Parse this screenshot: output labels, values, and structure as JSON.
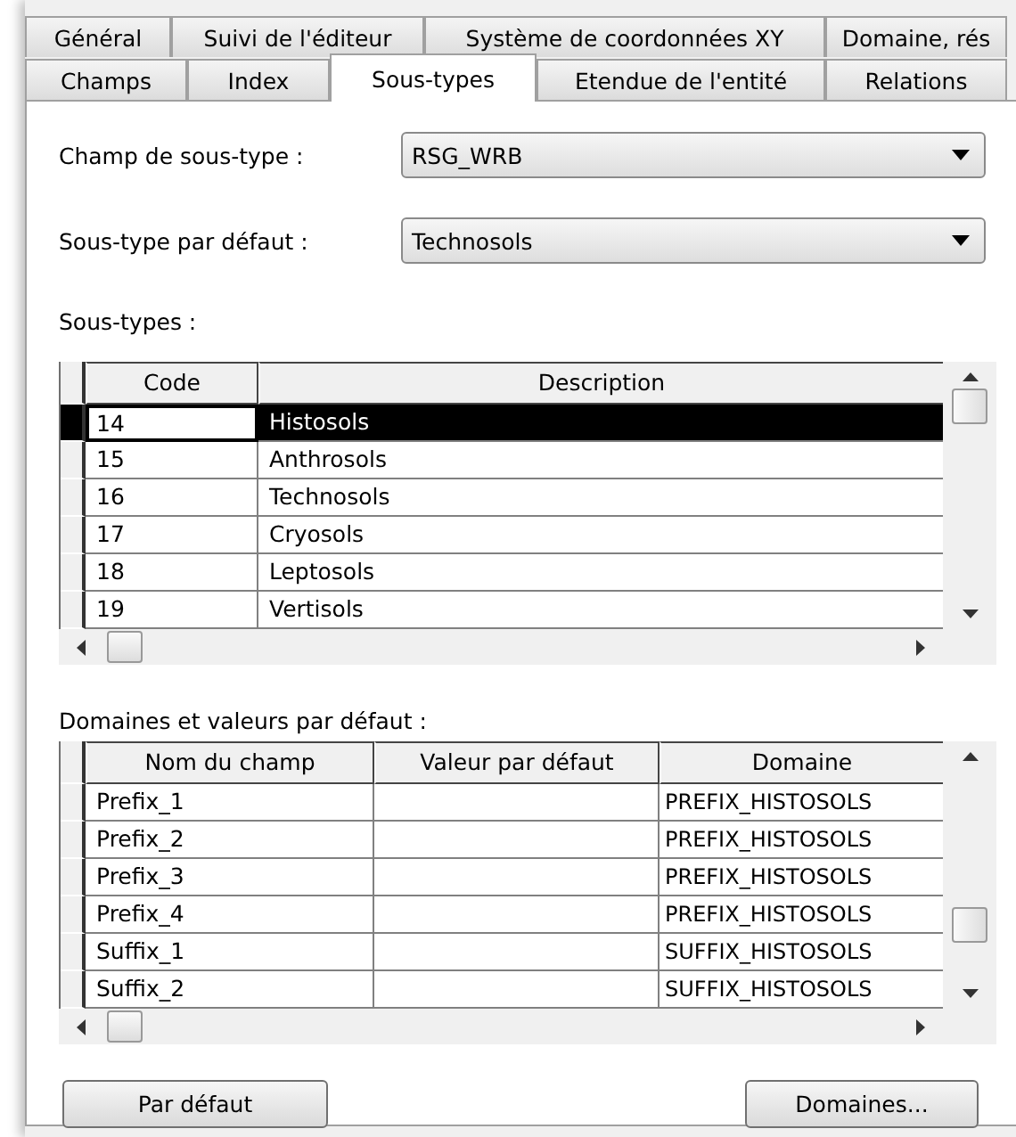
{
  "tab_rows": [
    [
      {
        "label": "Général",
        "selected": false
      },
      {
        "label": "Suivi de l'éditeur",
        "selected": false
      },
      {
        "label": "Système de coordonnées XY",
        "selected": false
      },
      {
        "label": "Domaine, rés",
        "selected": false
      }
    ],
    [
      {
        "label": "Champs",
        "selected": false
      },
      {
        "label": "Index",
        "selected": false
      },
      {
        "label": "Sous-types",
        "selected": true
      },
      {
        "label": "Etendue de l'entité",
        "selected": false
      },
      {
        "label": "Relations",
        "selected": false
      }
    ]
  ],
  "subtype_field": {
    "label": "Champ de sous-type :",
    "value": "RSG_WRB"
  },
  "default_subtype": {
    "label": "Sous-type par défaut :",
    "value": "Technosols"
  },
  "subtypes_label": "Sous-types :",
  "subtypes_table": {
    "columns": [
      "Code",
      "Description"
    ],
    "rows": [
      {
        "cells": [
          "14",
          "Histosols"
        ],
        "selected": true
      },
      {
        "cells": [
          "15",
          "Anthrosols"
        ],
        "selected": false
      },
      {
        "cells": [
          "16",
          "Technosols"
        ],
        "selected": false
      },
      {
        "cells": [
          "17",
          "Cryosols"
        ],
        "selected": false
      },
      {
        "cells": [
          "18",
          "Leptosols"
        ],
        "selected": false
      },
      {
        "cells": [
          "19",
          "Vertisols"
        ],
        "selected": false
      }
    ]
  },
  "domains_label": "Domaines et valeurs par défaut :",
  "domains_table": {
    "columns": [
      "Nom du champ",
      "Valeur par défaut",
      "Domaine"
    ],
    "rows": [
      {
        "cells": [
          "Prefix_1",
          "",
          "PREFIX_HISTOSOLS"
        ],
        "selected": false
      },
      {
        "cells": [
          "Prefix_2",
          "",
          "PREFIX_HISTOSOLS"
        ],
        "selected": false
      },
      {
        "cells": [
          "Prefix_3",
          "",
          "PREFIX_HISTOSOLS"
        ],
        "selected": false
      },
      {
        "cells": [
          "Prefix_4",
          "",
          "PREFIX_HISTOSOLS"
        ],
        "selected": false
      },
      {
        "cells": [
          "Suffix_1",
          "",
          "SUFFIX_HISTOSOLS"
        ],
        "selected": false
      },
      {
        "cells": [
          "Suffix_2",
          "",
          "SUFFIX_HISTOSOLS"
        ],
        "selected": false
      }
    ]
  },
  "buttons": [
    "Par défaut",
    "Domaines..."
  ]
}
